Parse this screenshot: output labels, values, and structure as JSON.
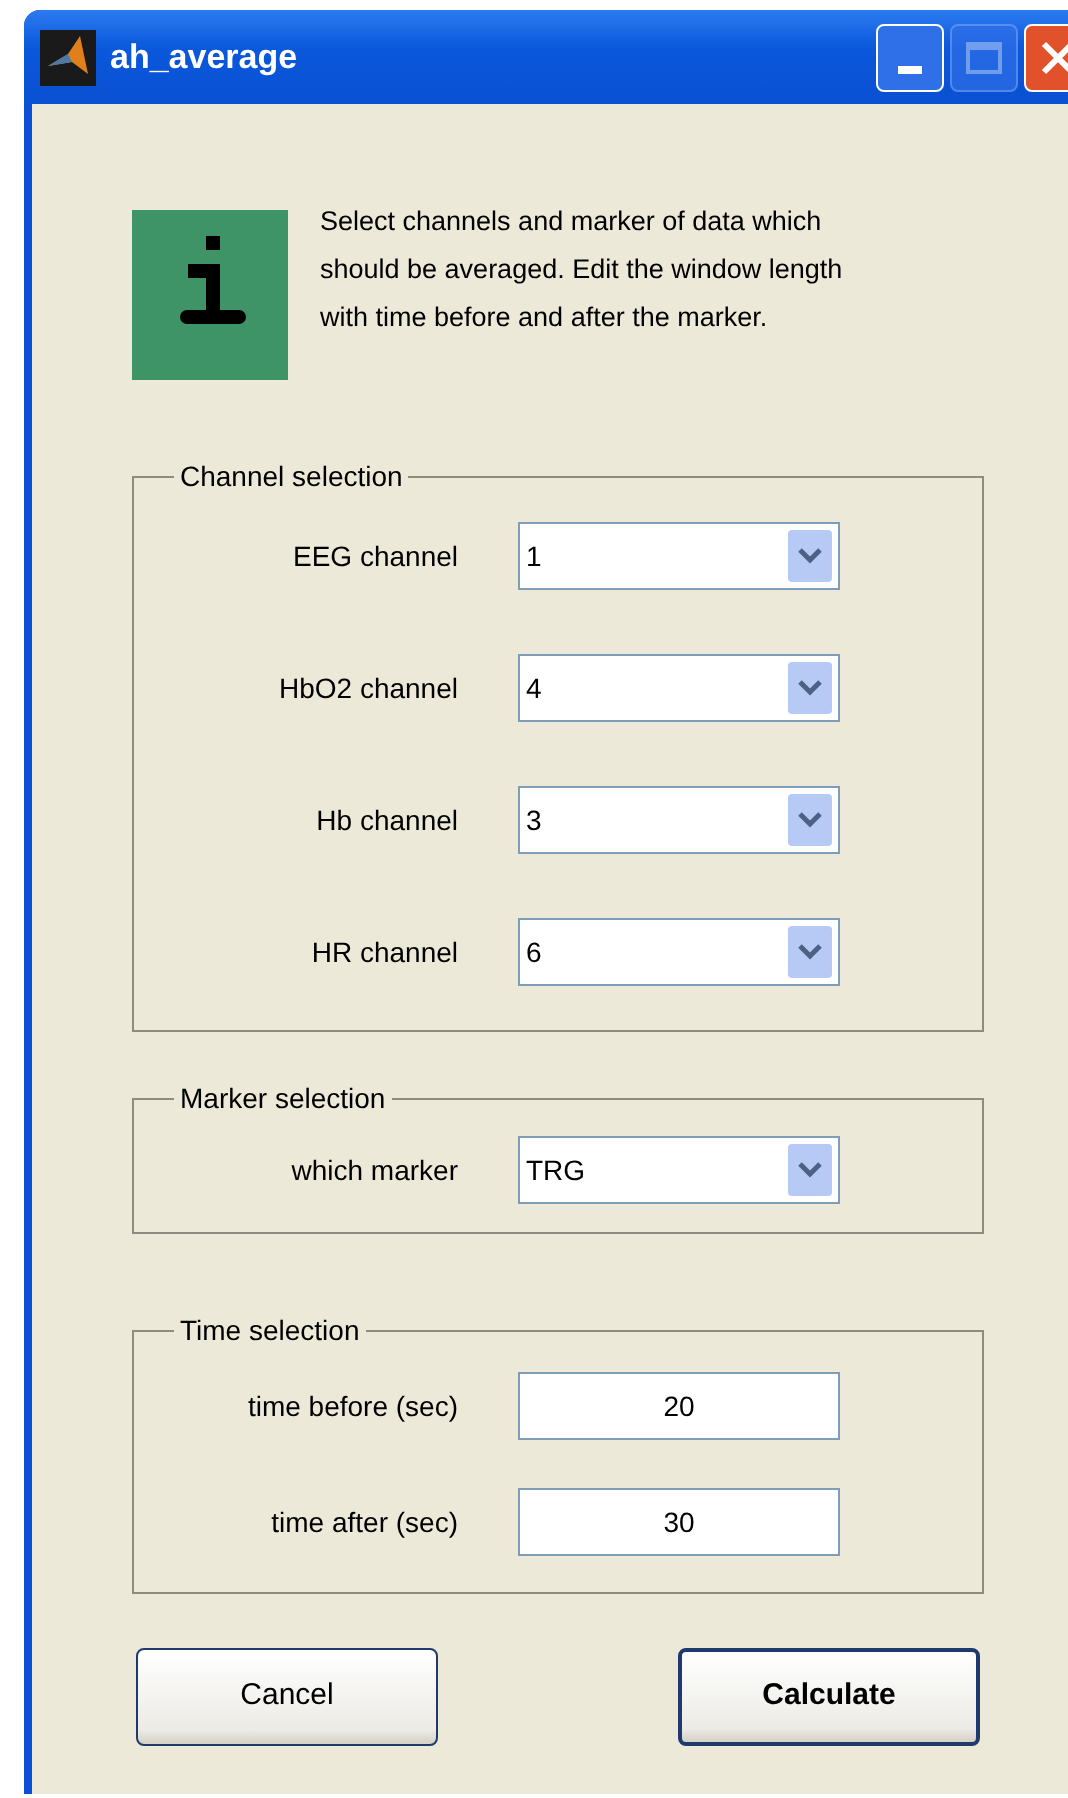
{
  "window": {
    "title": "ah_average"
  },
  "info": {
    "text": "Select channels and marker of data which should be averaged. Edit the window length with time before and after the marker."
  },
  "groups": [
    {
      "title": "Channel selection",
      "rows": [
        {
          "kind": "dropdown",
          "label": "EEG channel",
          "value": "1"
        },
        {
          "kind": "dropdown",
          "label": "HbO2 channel",
          "value": "4"
        },
        {
          "kind": "dropdown",
          "label": "Hb channel",
          "value": "3"
        },
        {
          "kind": "dropdown",
          "label": "HR channel",
          "value": "6"
        }
      ]
    },
    {
      "title": "Marker selection",
      "rows": [
        {
          "kind": "dropdown",
          "label": "which marker",
          "value": "TRG"
        }
      ]
    },
    {
      "title": "Time selection",
      "rows": [
        {
          "kind": "field",
          "label": "time before (sec)",
          "value": "20"
        },
        {
          "kind": "field",
          "label": "time after (sec)",
          "value": "30"
        }
      ]
    }
  ],
  "buttons": [
    {
      "label": "Cancel",
      "default": false
    },
    {
      "label": "Calculate",
      "default": true
    }
  ]
}
